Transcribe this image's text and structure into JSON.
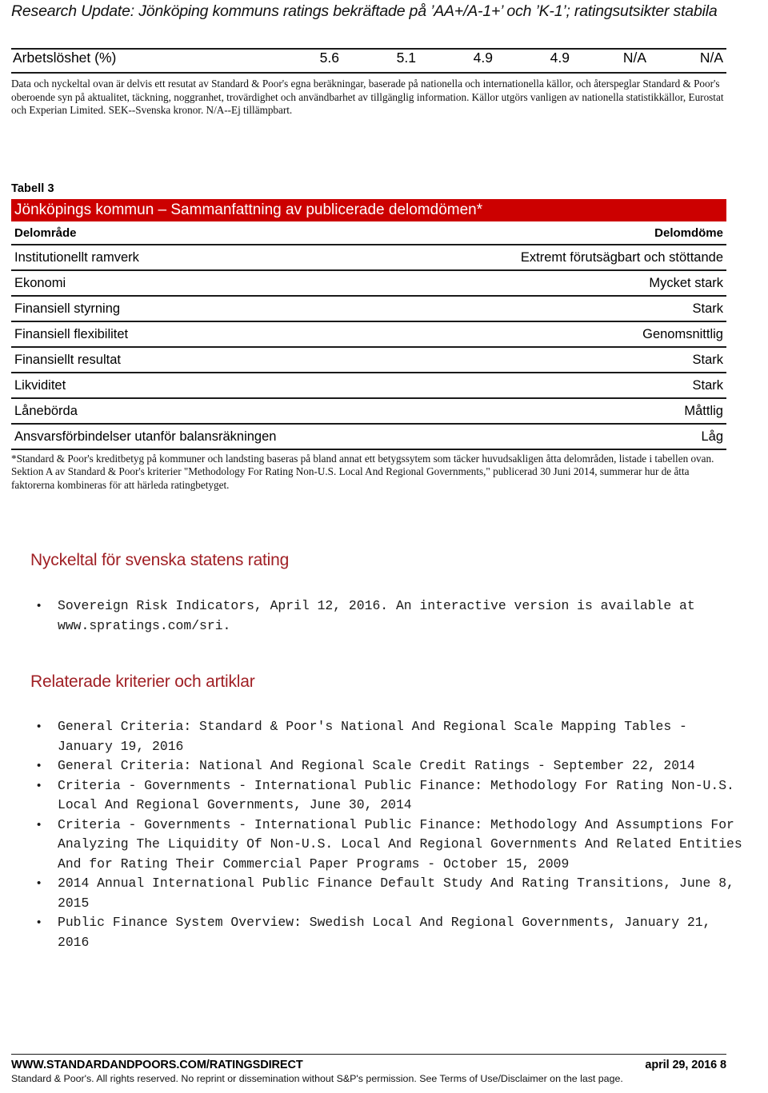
{
  "document": {
    "title": "Research Update: Jönköping kommuns ratings bekräftade på ’AA+/A-1+’ och ’K-1’; ratingsutsikter stabila",
    "accent_red": "#CC0000",
    "heading_red": "#A01F24"
  },
  "top_table": {
    "row": {
      "label": "Arbetslöshet (%)",
      "values": [
        "5.6",
        "5.1",
        "4.9",
        "4.9",
        "N/A",
        "N/A"
      ]
    },
    "note": "Data och nyckeltal ovan är delvis ett resutat av Standard & Poor's egna beräkningar, baserade på nationella och internationella källor, och återspeglar Standard & Poor's oberoende syn på aktualitet, täckning, noggranhet, trovärdighet och användbarhet av tillgänglig information. Källor utgörs vanligen av nationella statistikkällor, Eurostat och Experian Limited. SEK--Svenska kronor. N/A--Ej tillämpbart."
  },
  "table3": {
    "caption": "Tabell 3",
    "banner": "Jönköpings kommun – Sammanfattning av publicerade delomdömen*",
    "columns": {
      "left": "Delområde",
      "right": "Delomdöme"
    },
    "rows": [
      {
        "area": "Institutionellt ramverk",
        "assessment": "Extremt förutsägbart och stöttande"
      },
      {
        "area": "Ekonomi",
        "assessment": "Mycket stark"
      },
      {
        "area": "Finansiell styrning",
        "assessment": "Stark"
      },
      {
        "area": "Finansiell flexibilitet",
        "assessment": "Genomsnittlig"
      },
      {
        "area": "Finansiellt resultat",
        "assessment": "Stark"
      },
      {
        "area": "Likviditet",
        "assessment": "Stark"
      },
      {
        "area": "Lånebörda",
        "assessment": "Måttlig"
      },
      {
        "area": "Ansvarsförbindelser utanför balansräkningen",
        "assessment": "Låg"
      }
    ],
    "footnote": "*Standard & Poor's kreditbetyg på kommuner och landsting baseras på bland annat ett betygssytem som täcker huvudsakligen åtta delområden, listade i tabellen ovan. Sektion A av Standard & Poor's kriterier \"Methodology For Rating Non-U.S. Local And Regional Governments,\" publicerad 30 Juni 2014, summerar hur de åtta faktorerna kombineras för att härleda ratingbetyget."
  },
  "sections": {
    "sovereign": {
      "heading": "Nyckeltal för svenska statens rating",
      "items": [
        "Sovereign Risk Indicators, April 12, 2016. An interactive version is available at www.spratings.com/sri."
      ]
    },
    "related": {
      "heading": "Relaterade kriterier och artiklar",
      "items": [
        "General Criteria: Standard & Poor's National And Regional Scale Mapping Tables - January 19, 2016",
        "General Criteria: National And Regional Scale Credit Ratings - September 22, 2014",
        "Criteria - Governments - International Public Finance: Methodology For Rating Non-U.S. Local And Regional Governments, June 30, 2014",
        "Criteria - Governments - International Public Finance: Methodology And Assumptions For Analyzing The Liquidity Of Non-U.S. Local And Regional Governments And Related Entities And for Rating Their Commercial Paper Programs - October 15, 2009",
        "2014 Annual International Public Finance Default Study And Rating Transitions, June 8, 2015",
        "Public Finance System Overview: Swedish Local And Regional Governments, January 21, 2016"
      ]
    },
    "bullet_glyph": "•"
  },
  "footer": {
    "site": "WWW.STANDARDANDPOORS.COM/RATINGSDIRECT",
    "page_info": "april 29, 2016  8",
    "disclaimer": "Standard & Poor's. All rights reserved. No reprint or dissemination without S&P's permission. See Terms of Use/Disclaimer on the last page."
  }
}
